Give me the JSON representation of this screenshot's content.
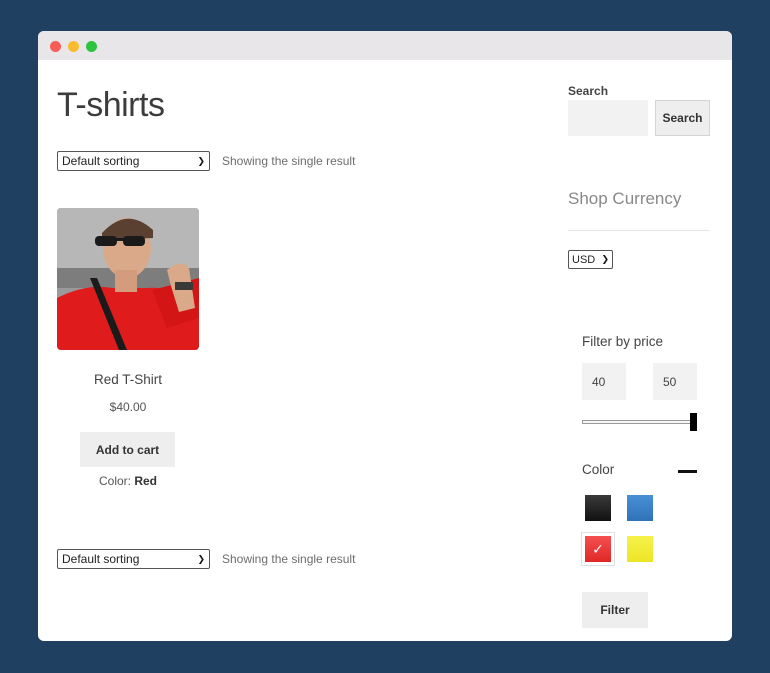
{
  "page": {
    "title": "T-shirts"
  },
  "toolbar": {
    "sorting_top": "Default sorting",
    "result_count_top": "Showing the single result",
    "sorting_bottom": "Default sorting",
    "result_count_bottom": "Showing the single result"
  },
  "product": {
    "name": "Red T-Shirt",
    "price": "$40.00",
    "add_to_cart_label": "Add to cart",
    "attribute_label": "Color:",
    "attribute_value": "Red"
  },
  "sidebar": {
    "search": {
      "label": "Search",
      "value": "",
      "button_label": "Search"
    },
    "currency": {
      "title": "Shop Currency",
      "selected": "USD"
    },
    "price_filter": {
      "title": "Filter by price",
      "min_value": "40",
      "max_value": "50"
    },
    "color_filter": {
      "title": "Color",
      "swatches": [
        {
          "name": "black",
          "color": "#1e1e1e",
          "selected": false
        },
        {
          "name": "blue",
          "color": "#3d82c9",
          "selected": false
        },
        {
          "name": "red",
          "color": "#f03a3a",
          "selected": true
        },
        {
          "name": "yellow",
          "color": "#f1ec36",
          "selected": false
        }
      ]
    },
    "filter_button_label": "Filter"
  },
  "colors": {
    "background": "#1f4060",
    "button": "#eeeeee"
  }
}
